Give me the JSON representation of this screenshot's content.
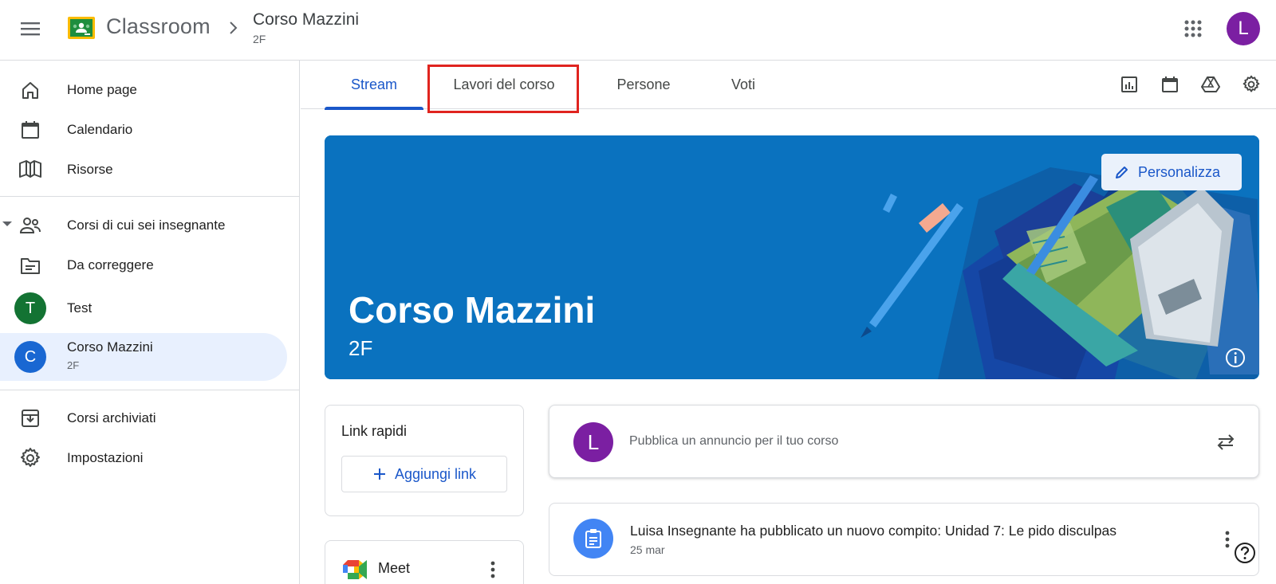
{
  "header": {
    "app_name": "Classroom",
    "course_title": "Corso Mazzini",
    "course_section": "2F",
    "avatar_letter": "L"
  },
  "sidebar": {
    "items": [
      {
        "label": "Home page",
        "icon": "home-icon"
      },
      {
        "label": "Calendario",
        "icon": "calendar-icon"
      },
      {
        "label": "Risorse",
        "icon": "book-icon"
      },
      {
        "label": "Corsi di cui sei insegnante",
        "icon": "people-icon"
      },
      {
        "label": "Da correggere",
        "icon": "folder-icon"
      },
      {
        "label": "Test",
        "letter": "T",
        "color": "#137333"
      },
      {
        "label": "Corso Mazzini",
        "sublabel": "2F",
        "letter": "C",
        "color": "#1967d2"
      },
      {
        "label": "Corsi archiviati",
        "icon": "archive-icon"
      },
      {
        "label": "Impostazioni",
        "icon": "settings-icon"
      }
    ]
  },
  "tabs": [
    {
      "label": "Stream",
      "active": true
    },
    {
      "label": "Lavori del corso",
      "active": false
    },
    {
      "label": "Persone",
      "active": false
    },
    {
      "label": "Voti",
      "active": false
    }
  ],
  "banner": {
    "title": "Corso Mazzini",
    "subtitle": "2F",
    "customize_label": "Personalizza",
    "color": "#0a72bf"
  },
  "quick_links": {
    "title": "Link rapidi",
    "add_label": "Aggiungi link"
  },
  "meet": {
    "label": "Meet"
  },
  "announce": {
    "avatar_letter": "L",
    "placeholder": "Pubblica un annuncio per il tuo corso"
  },
  "post": {
    "text": "Luisa Insegnante ha pubblicato un nuovo compito: Unidad 7: Le pido disculpas",
    "date": "25 mar"
  },
  "colors": {
    "accent": "#1a57c9",
    "highlight": "#e0241f"
  }
}
